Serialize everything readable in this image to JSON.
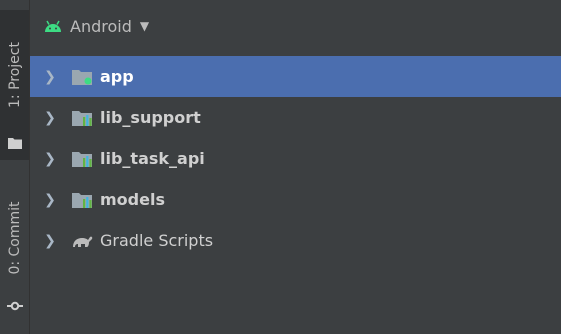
{
  "strip": {
    "project_tab": "1: Project",
    "commit_tab": "0: Commit"
  },
  "header": {
    "view_mode": "Android",
    "android_icon": "android-icon",
    "caret_icon": "chevron-down-icon"
  },
  "tree": {
    "items": [
      {
        "label": "app",
        "icon": "module-folder-icon",
        "selected": true
      },
      {
        "label": "lib_support",
        "icon": "library-folder-icon",
        "selected": false
      },
      {
        "label": "lib_task_api",
        "icon": "library-folder-icon",
        "selected": false
      },
      {
        "label": "models",
        "icon": "library-folder-icon",
        "selected": false
      },
      {
        "label": "Gradle Scripts",
        "icon": "gradle-icon",
        "selected": false
      }
    ]
  },
  "colors": {
    "background": "#3c3f41",
    "selection": "#4b6eaf",
    "text": "#bbbbbb",
    "android_green": "#3ddc84"
  }
}
